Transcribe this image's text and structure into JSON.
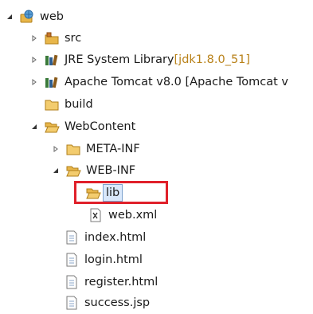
{
  "tree": {
    "items": [
      {
        "label": "web",
        "decoration": "",
        "icon": "web-project-icon",
        "expanded": true
      },
      {
        "label": "src",
        "decoration": "",
        "icon": "source-folder-icon",
        "expanded": false
      },
      {
        "label": "JRE System Library ",
        "decoration": "[jdk1.8.0_51]",
        "icon": "library-icon",
        "expanded": false
      },
      {
        "label": "Apache Tomcat v8.0 [Apache Tomcat v",
        "decoration": "",
        "icon": "library-icon",
        "expanded": false
      },
      {
        "label": "build",
        "decoration": "",
        "icon": "folder-icon"
      },
      {
        "label": "WebContent",
        "decoration": "",
        "icon": "folder-icon",
        "expanded": true
      },
      {
        "label": "META-INF",
        "decoration": "",
        "icon": "folder-icon",
        "expanded": false
      },
      {
        "label": "WEB-INF",
        "decoration": "",
        "icon": "folder-icon",
        "expanded": true
      },
      {
        "label": "lib",
        "decoration": "",
        "icon": "folder-open-icon",
        "selected": true
      },
      {
        "label": "web.xml",
        "decoration": "",
        "icon": "xml-file-icon"
      },
      {
        "label": "index.html",
        "decoration": "",
        "icon": "file-icon"
      },
      {
        "label": "login.html",
        "decoration": "",
        "icon": "file-icon"
      },
      {
        "label": "register.html",
        "decoration": "",
        "icon": "file-icon"
      },
      {
        "label": "success.jsp",
        "decoration": "",
        "icon": "file-icon"
      }
    ]
  },
  "colors": {
    "folder": "#e8b64a",
    "decoration": "#b9821a",
    "selection_bg": "#d9e8fb",
    "highlight": "#e0202a"
  }
}
